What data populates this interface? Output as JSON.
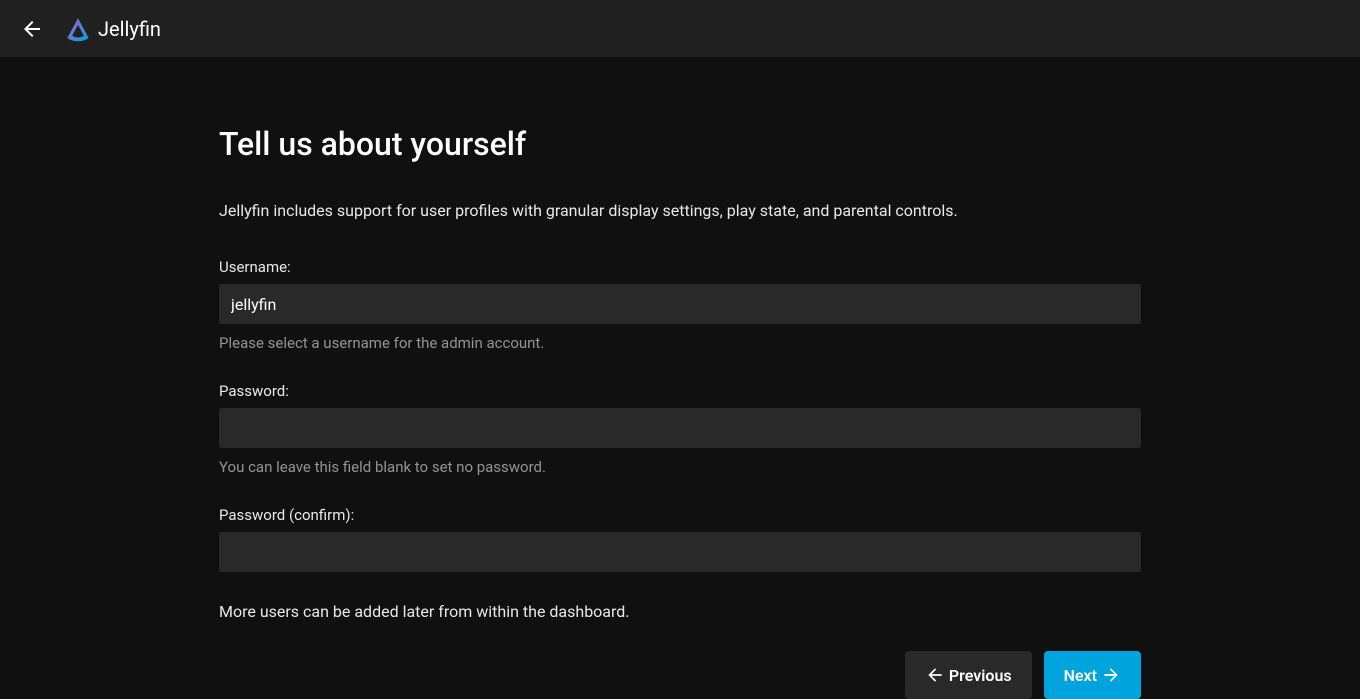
{
  "header": {
    "logo_text": "Jellyfin"
  },
  "page": {
    "title": "Tell us about yourself",
    "intro": "Jellyfin includes support for user profiles with granular display settings, play state, and parental controls.",
    "more_users": "More users can be added later from within the dashboard."
  },
  "fields": {
    "username": {
      "label": "Username:",
      "value": "jellyfin",
      "help": "Please select a username for the admin account."
    },
    "password": {
      "label": "Password:",
      "value": "",
      "help": "You can leave this field blank to set no password."
    },
    "password_confirm": {
      "label": "Password (confirm):",
      "value": ""
    }
  },
  "buttons": {
    "previous": "Previous",
    "next": "Next"
  }
}
